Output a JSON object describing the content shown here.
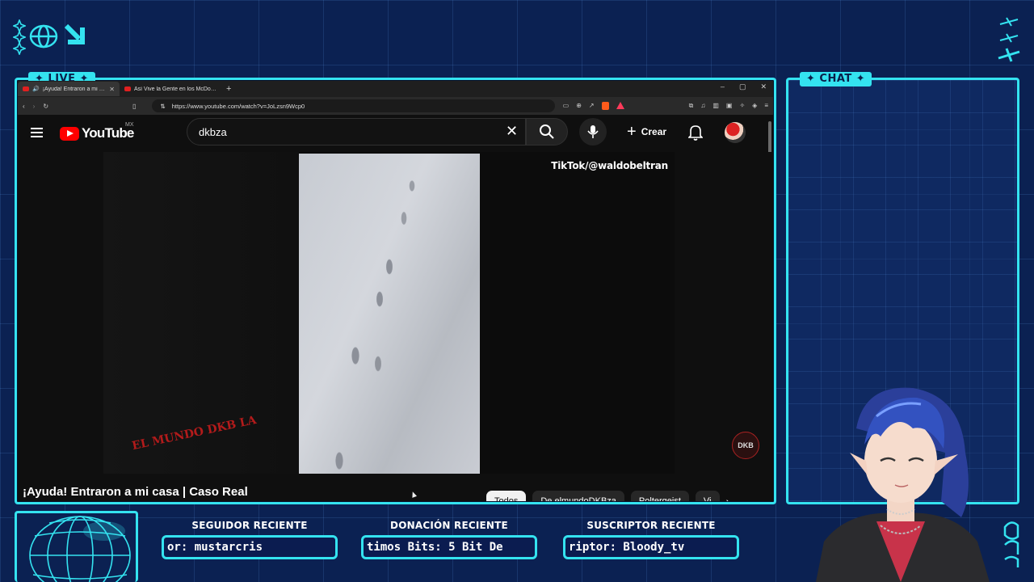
{
  "overlay": {
    "live_label": "✦ LIVE ✦",
    "chat_label": "✦ CHAT ✦",
    "stats": [
      {
        "label": "SEGUIDOR RECIENTE",
        "value": "or: mustarcris"
      },
      {
        "label": "DONACIÓN RECIENTE",
        "value": "timos Bits: 5 Bit De"
      },
      {
        "label": "SUSCRIPTOR RECIENTE",
        "value": "riptor: Bloody_tv"
      }
    ],
    "accent_color": "#34e3f0",
    "background_color": "#0b2152"
  },
  "browser": {
    "tabs": [
      {
        "title": "¡Ayuda! Entraron a mi casa | C",
        "active": true
      },
      {
        "title": "Así Vive la Gente en los McDonalds d",
        "active": false
      }
    ],
    "new_tab": "+",
    "window_controls": [
      "–",
      "▢",
      "✕"
    ],
    "url": "https://www.youtube.com/watch?v=JoLzsn9Wcp0"
  },
  "youtube": {
    "logo_text": "YouTube",
    "country": "MX",
    "search_value": "dkbza",
    "create_label": "Crear",
    "video": {
      "title": "¡Ayuda! Entraron a mi casa | Caso Real",
      "overlay_credit": "TikTok/@waldobeltran",
      "watermark_left": "EL MUNDO DKB LA",
      "watermark_right": "DKB"
    },
    "chips": [
      "Todos",
      "De elmundoDKBza",
      "Poltergeist",
      "Vi"
    ],
    "active_chip": "Todos"
  }
}
